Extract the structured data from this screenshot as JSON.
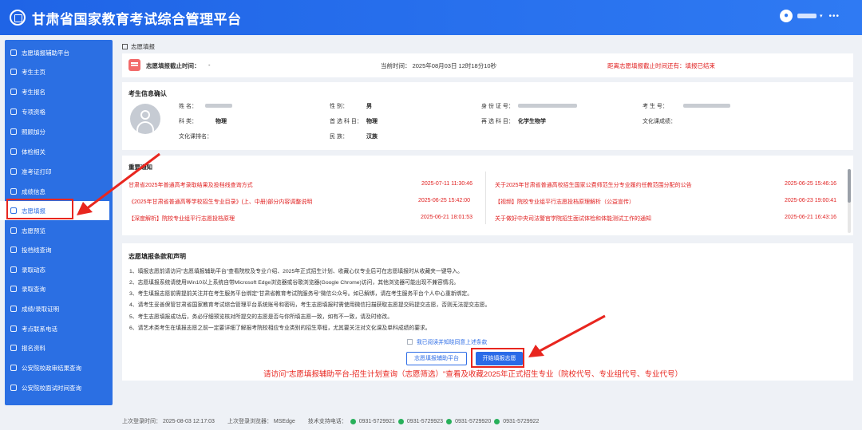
{
  "header": {
    "title": "甘肃省国家教育考试综合管理平台",
    "caret": "▾",
    "dots": "•••"
  },
  "sidebar": {
    "items": [
      {
        "label": "志愿填报辅助平台"
      },
      {
        "label": "考生主页"
      },
      {
        "label": "考生报名"
      },
      {
        "label": "专项资格"
      },
      {
        "label": "照顾加分"
      },
      {
        "label": "体检相关"
      },
      {
        "label": "准考证打印"
      },
      {
        "label": "成绩信息"
      },
      {
        "label": "志愿填报"
      },
      {
        "label": "志愿预览"
      },
      {
        "label": "投档线查询"
      },
      {
        "label": "录取动态"
      },
      {
        "label": "录取查询"
      },
      {
        "label": "成绩/录取证明"
      },
      {
        "label": "考点联系电话"
      },
      {
        "label": "报名资料"
      },
      {
        "label": "公安院校政审结果查询"
      },
      {
        "label": "公安院校面试时间查询"
      }
    ]
  },
  "breadcrumb": "志愿填报",
  "deadline": {
    "label": "志愿填报截止时间：",
    "value": "-",
    "current": "当前时间：  2025年08月03日 12时18分10秒",
    "remaining": "距离志愿填报截止时间还有：填报已结束"
  },
  "student": {
    "title": "考生信息确认",
    "fields": {
      "name_label": "姓          名：",
      "gender_label": "性          别：",
      "gender_value": "男",
      "id_label": "身 份 证 号：",
      "exam_no_label": "考     生     号：",
      "subject_label": "科          类：",
      "subject_value": "物理",
      "first_label": "首 选 科 目：",
      "first_value": "物理",
      "second_label": "再 选 科 目：",
      "second_value": "化学生物学",
      "culture_score_label": "文化课成绩：",
      "culture_subject_label": "文化课排名：",
      "ethnic_label": "民          族：",
      "ethnic_value": "汉族"
    }
  },
  "notices": {
    "title": "重要通知",
    "left": [
      {
        "text": "甘肃省2025年普通高考录取结果及投档线查询方式",
        "date": "2025-07-11 11:30:46"
      },
      {
        "text": "《2025年甘肃省普通高等学校招生专业目录》(上、中册)部分内容调整说明",
        "date": "2025-06-25 15:42:00"
      },
      {
        "text": "【深度解析】院校专业组平行志愿投档原理",
        "date": "2025-06-21 18:01:53"
      }
    ],
    "right": [
      {
        "text": "关于2025年甘肃省普通高校招生国家公费师范生分专业履约任教范围分配的公告",
        "date": "2025-06-25 15:46:16"
      },
      {
        "text": "【视频】院校专业组平行志愿投档原理解析（公益宣传）",
        "date": "2025-06-23 19:00:41"
      },
      {
        "text": "关于做好中央司法警官学院招生面试体检和体能测试工作的通知",
        "date": "2025-06-21 16:43:16"
      }
    ]
  },
  "terms": {
    "title": "志愿填报条款和声明",
    "lines": [
      "1、填报志愿前请访问\"志愿填报辅助平台\"查看院校及专业介绍、2025年正式招生计划、收藏心仪专业后可在志愿填报时从收藏夹一键导入。",
      "2、志愿填报系统请使用Win10以上系统自带Microsoft Edge浏览器或谷歌浏览器(Google Chrome)访问，其他浏览器可能出现不兼容情况。",
      "3、考生填报志愿前需提前关注并在考生服务平台绑定\"甘肃省教育考试院服务号\"微信公众号。如已解绑，请在考生服务平台个人中心重新绑定。",
      "4、请考生妥善保管甘肃省国家教育考试综合管理平台系统账号和密码，考生志愿填报时需使用微信扫描获取志愿提交码提交志愿，否则无法提交志愿。",
      "5、考生志愿填报成功后，务必仔细预览核对所提交的志愿是否与你所填志愿一致，如有不一致，请及时修改。",
      "6、请艺术类考生在填报志愿之前一定要详细了解报考院校相应专业类别的招生章程，尤其要关注对文化课及单科成绩的要求。"
    ],
    "agree": "我已阅读并知晓同意上述条款",
    "btn_assist": "志愿填报辅助平台",
    "btn_start": "开始填报志愿"
  },
  "annotation": "请访问\"志愿填报辅助平台-招生计划查询（志愿筛选）\"查看及收藏2025年正式招生专业（院校代号、专业组代号、专业代号）",
  "footer": {
    "last_login": "上次登录时间：  2025-08-03 12:17:03",
    "last_browser": "上次登录浏览器：  MSEdge",
    "support": "技术支持电话：",
    "phones": [
      "0931-5729921",
      "0931-5729923",
      "0931-5729920",
      "0931-5729922"
    ]
  },
  "colors": {
    "brand": "#2b6fe3",
    "alert": "#e02020",
    "annotation": "#e8261f"
  }
}
